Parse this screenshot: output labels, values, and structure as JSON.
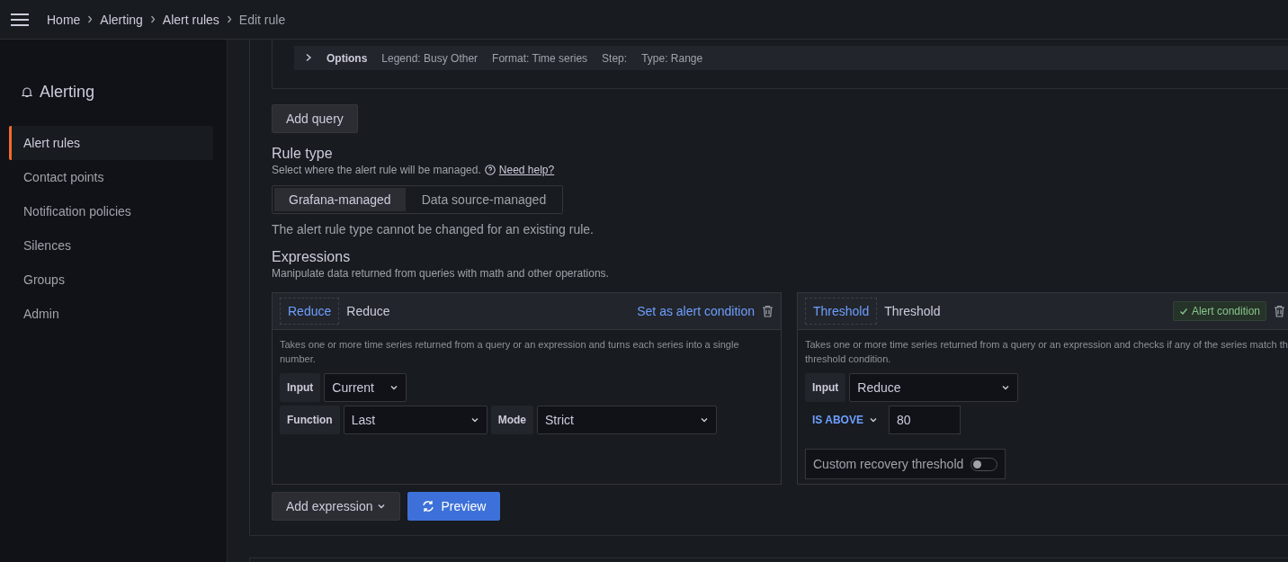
{
  "topbar": {
    "breadcrumbs": [
      {
        "label": "Home",
        "current": false
      },
      {
        "label": "Alerting",
        "current": false
      },
      {
        "label": "Alert rules",
        "current": false
      },
      {
        "label": "Edit rule",
        "current": true
      }
    ]
  },
  "sidebar": {
    "title": "Alerting",
    "items": [
      {
        "label": "Alert rules",
        "selected": true
      },
      {
        "label": "Contact points",
        "selected": false
      },
      {
        "label": "Notification policies",
        "selected": false
      },
      {
        "label": "Silences",
        "selected": false
      },
      {
        "label": "Groups",
        "selected": false
      },
      {
        "label": "Admin",
        "selected": false
      }
    ]
  },
  "query_options": {
    "label": "Options",
    "items": [
      "Legend: Busy Other",
      "Format: Time series",
      "Step:",
      "Type: Range"
    ]
  },
  "add_query_button": "Add query",
  "rule_type": {
    "title": "Rule type",
    "description": "Select where the alert rule will be managed.",
    "help_link": "Need help?",
    "options": [
      {
        "label": "Grafana-managed",
        "selected": true
      },
      {
        "label": "Data source-managed",
        "selected": false
      }
    ],
    "note": "The alert rule type cannot be changed for an existing rule."
  },
  "expressions": {
    "title": "Expressions",
    "description": "Manipulate data returned from queries with math and other operations.",
    "cards": [
      {
        "kind": "reduce",
        "type_label": "Reduce",
        "name": "Reduce",
        "alert_condition": false,
        "condition_label": "Set as alert condition",
        "description_lines": [
          "Takes one or more time series returned from a query or an expression and turns each series into a single",
          "number."
        ],
        "rows": [
          [
            {
              "label": "Input",
              "value": "Current"
            }
          ],
          [
            {
              "label": "Function",
              "value": "Last"
            },
            {
              "label": "Mode",
              "value": "Strict"
            }
          ]
        ]
      },
      {
        "kind": "threshold",
        "type_label": "Threshold",
        "name": "Threshold",
        "alert_condition": true,
        "condition_label": "Alert condition",
        "description_lines": [
          "Takes one or more time series returned from a query or an expression and checks if any of the series match th",
          "threshold condition."
        ],
        "input": {
          "label": "Input",
          "value": "Reduce"
        },
        "operator": "IS ABOVE",
        "threshold_value": "80",
        "recovery": {
          "label": "Custom recovery threshold",
          "on": false
        }
      }
    ],
    "add_button": "Add expression",
    "preview_button": "Preview"
  }
}
